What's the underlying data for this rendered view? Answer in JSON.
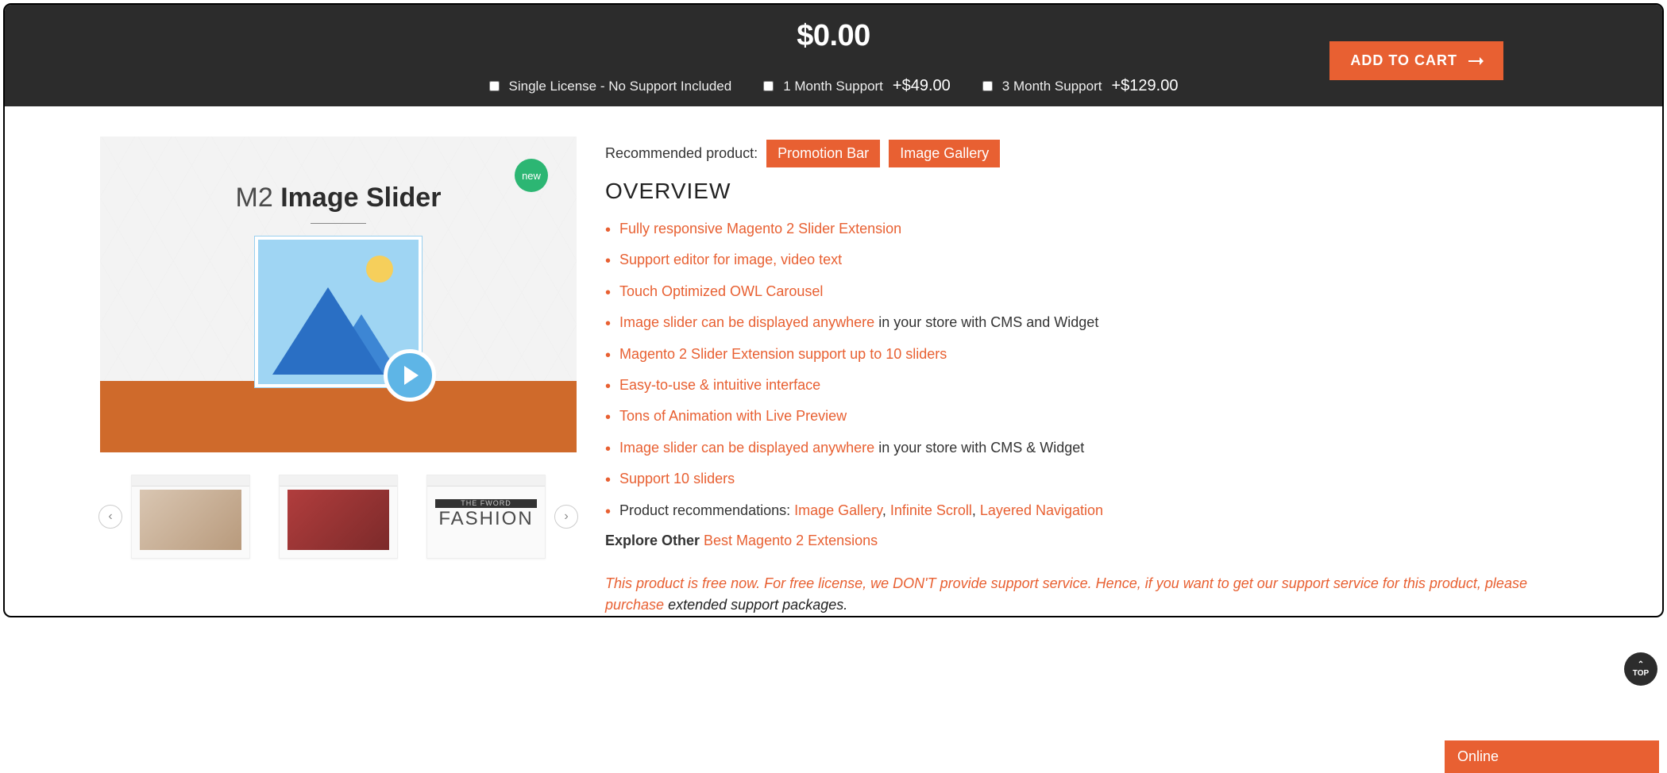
{
  "topbar": {
    "price": "$0.00",
    "add_to_cart": "ADD TO CART",
    "options": [
      {
        "label": "Single License - No Support Included",
        "extra": ""
      },
      {
        "label": "1 Month Support ",
        "extra": "+$49.00"
      },
      {
        "label": "3 Month Support ",
        "extra": "+$129.00"
      }
    ]
  },
  "product_image": {
    "title_prefix": "M2 ",
    "title_bold": "Image Slider",
    "badge": "new"
  },
  "thumbs": {
    "t3_small": "THE FWORD",
    "t3_big": "FASHION"
  },
  "right": {
    "rec_label": "Recommended product:",
    "rec_buttons": [
      "Promotion Bar",
      "Image Gallery"
    ],
    "overview": "OVERVIEW",
    "features": [
      {
        "link": "Fully responsive Magento 2 Slider Extension"
      },
      {
        "link": "Support editor for image, video text"
      },
      {
        "link": "Touch Optimized OWL Carousel"
      },
      {
        "link_a": "Image slider can be displayed anywhere ",
        "plain": "in your store with CMS and Widget"
      },
      {
        "link": "Magento 2 Slider Extension support up to 10 sliders"
      },
      {
        "link": "Easy-to-use & intuitive interface"
      },
      {
        "link": "Tons of Animation with Live Preview"
      },
      {
        "link_a": "Image slider can be displayed anywhere ",
        "plain": "in your store with CMS & Widget"
      },
      {
        "link": "Support 10 sliders"
      }
    ],
    "rec_line_prefix": "Product recommendations: ",
    "rec_links": [
      "Image Gallery",
      "Infinite Scroll",
      "Layered Navigation"
    ],
    "explore_prefix": "Explore Other ",
    "explore_link": "Best Magento 2 Extensions",
    "notice_italic": "This product is free now. For free license, we DON'T provide support service. Hence, if you want to get our support service for this product, please purchase ",
    "notice_black": "extended support packages."
  },
  "top_btn": "TOP",
  "chat": "Online"
}
